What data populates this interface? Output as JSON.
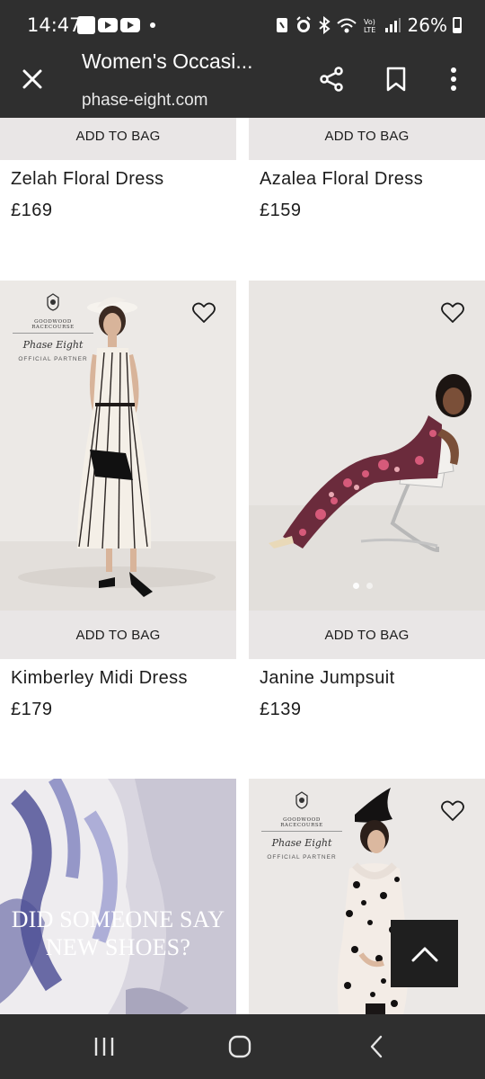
{
  "status_bar": {
    "time": "14:47",
    "battery": "26%",
    "icons": [
      "puzzle-icon",
      "youtube-icon",
      "youtube-icon",
      "dot-icon",
      "nfc-icon",
      "alarm-icon",
      "bluetooth-icon",
      "wifi-icon",
      "volte-icon",
      "signal-icon",
      "battery-icon"
    ]
  },
  "toolbar": {
    "title": "Women's Occasi...",
    "url": "phase-eight.com",
    "icons": [
      "close-icon",
      "share-icon",
      "bookmark-icon",
      "more-vertical-icon"
    ]
  },
  "products": {
    "add_to_bag_label": "ADD TO BAG",
    "row1": [
      {
        "name": "Zelah Floral Dress",
        "price": "£169"
      },
      {
        "name": "Azalea Floral Dress",
        "price": "£159"
      }
    ],
    "row2": [
      {
        "name": "Kimberley Midi Dress",
        "price": "£179"
      },
      {
        "name": "Janine Jumpsuit",
        "price": "£139"
      }
    ]
  },
  "badge": {
    "racecourse": "GOODWOOD RACECOURSE",
    "brand": "Phase Eight",
    "official": "OFFICIAL PARTNER"
  },
  "promo": {
    "line1": "DID SOMEONE SAY",
    "line2": "NEW SHOES?"
  },
  "colors": {
    "system_bar": "#2f2f2f",
    "add_to_bag_bg": "#e9e6e6",
    "back_to_top_bg": "#1f1f1f"
  },
  "nav": {
    "icons": [
      "recent-apps-icon",
      "home-icon",
      "back-icon"
    ]
  }
}
